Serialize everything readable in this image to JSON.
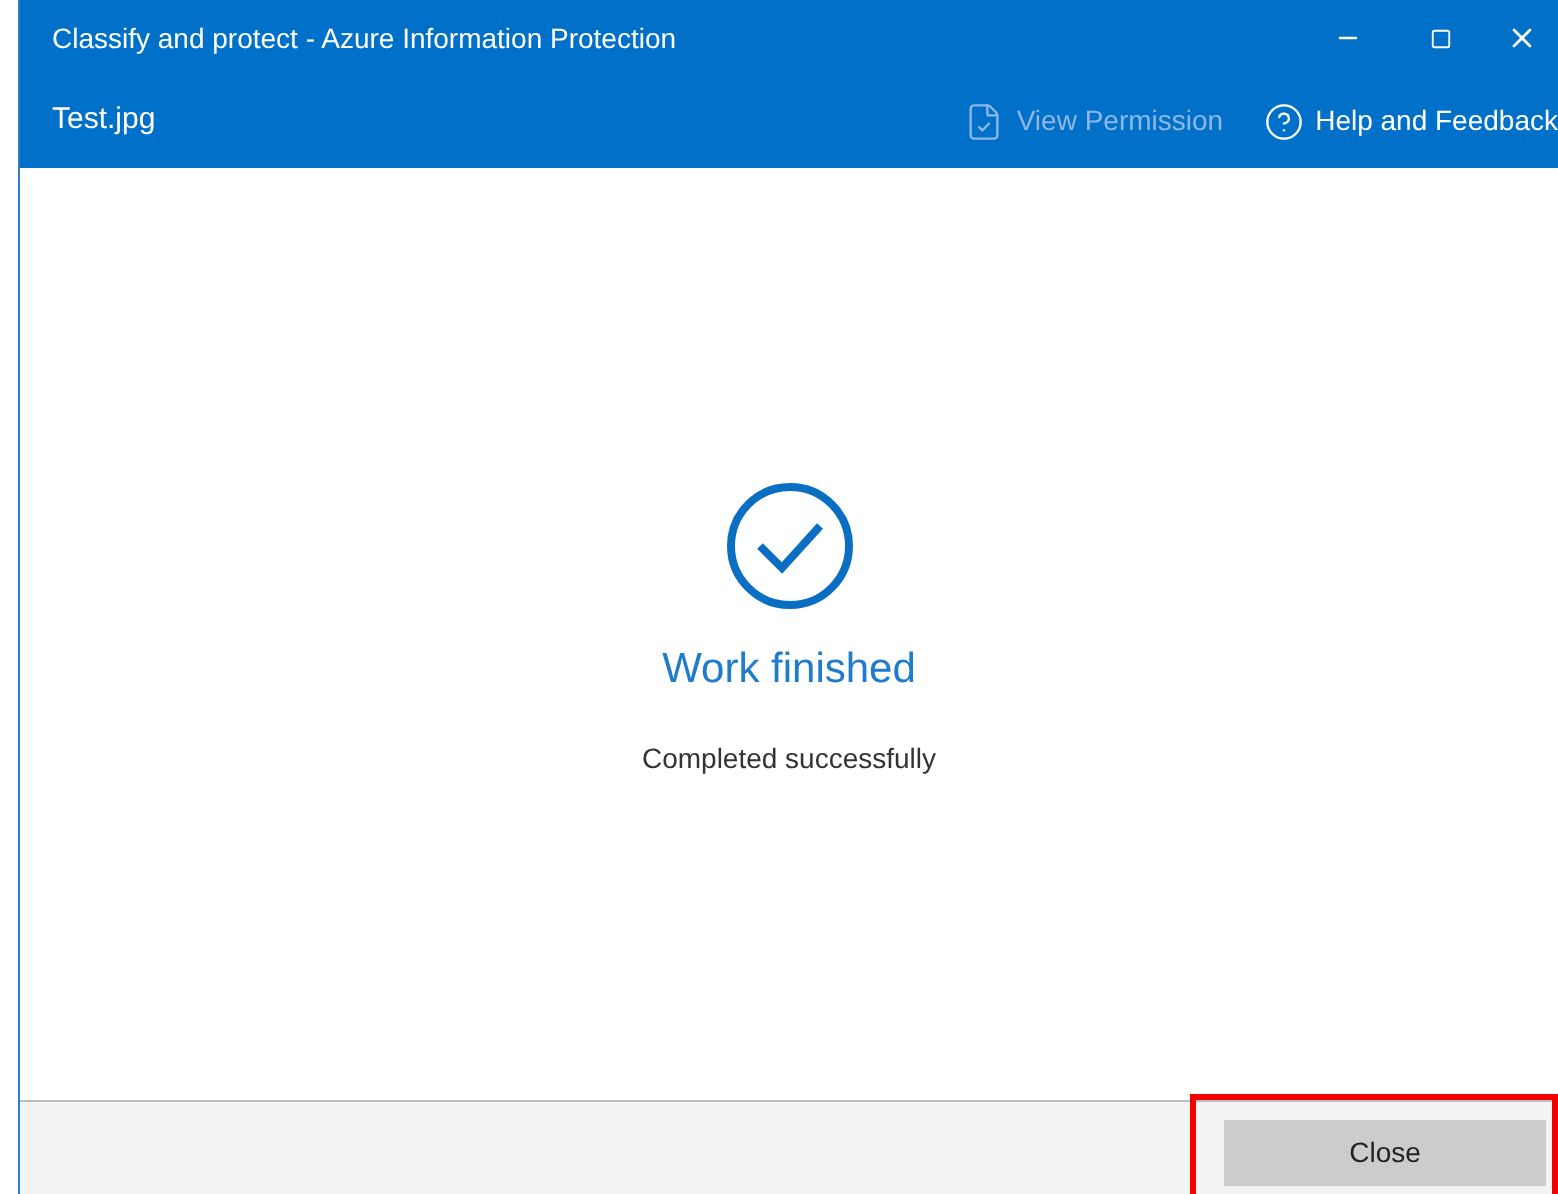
{
  "window": {
    "title": "Classify and protect - Azure Information Protection"
  },
  "header": {
    "file_name": "Test.jpg",
    "actions": [
      {
        "kind": "permission",
        "label": "View Permission",
        "disabled": true
      },
      {
        "kind": "help",
        "label": "Help and Feedback",
        "disabled": false
      }
    ]
  },
  "result": {
    "title": "Work finished",
    "message": "Completed successfully"
  },
  "footer": {
    "buttons": [
      {
        "label": "Close",
        "highlighted": true
      }
    ]
  }
}
